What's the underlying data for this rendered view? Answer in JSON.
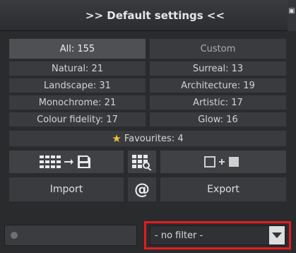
{
  "header": {
    "title": ">> Default settings <<"
  },
  "categories": {
    "row1": [
      {
        "label": "All: 155",
        "selected": true
      },
      {
        "label": "Custom",
        "selected": false
      }
    ],
    "row2": [
      {
        "label": "Natural: 21"
      },
      {
        "label": "Surreal: 13"
      }
    ],
    "row3": [
      {
        "label": "Landscape: 31"
      },
      {
        "label": "Architecture: 19"
      }
    ],
    "row4": [
      {
        "label": "Monochrome: 21"
      },
      {
        "label": "Artistic: 17"
      }
    ],
    "row5": [
      {
        "label": "Colour fidelity: 17"
      },
      {
        "label": "Glow: 16"
      }
    ]
  },
  "favourites": {
    "label": "Favourites: 4",
    "icon": "star-icon",
    "icon_color": "#f2c230"
  },
  "icon_buttons": [
    "grid-to-save-icon",
    "grid-magnifier-icon",
    "compare-images-icon"
  ],
  "actions": {
    "import_label": "Import",
    "at_symbol": "@",
    "export_label": "Export"
  },
  "filter": {
    "value": "- no filter -",
    "highlight_color": "#e61c1c"
  }
}
